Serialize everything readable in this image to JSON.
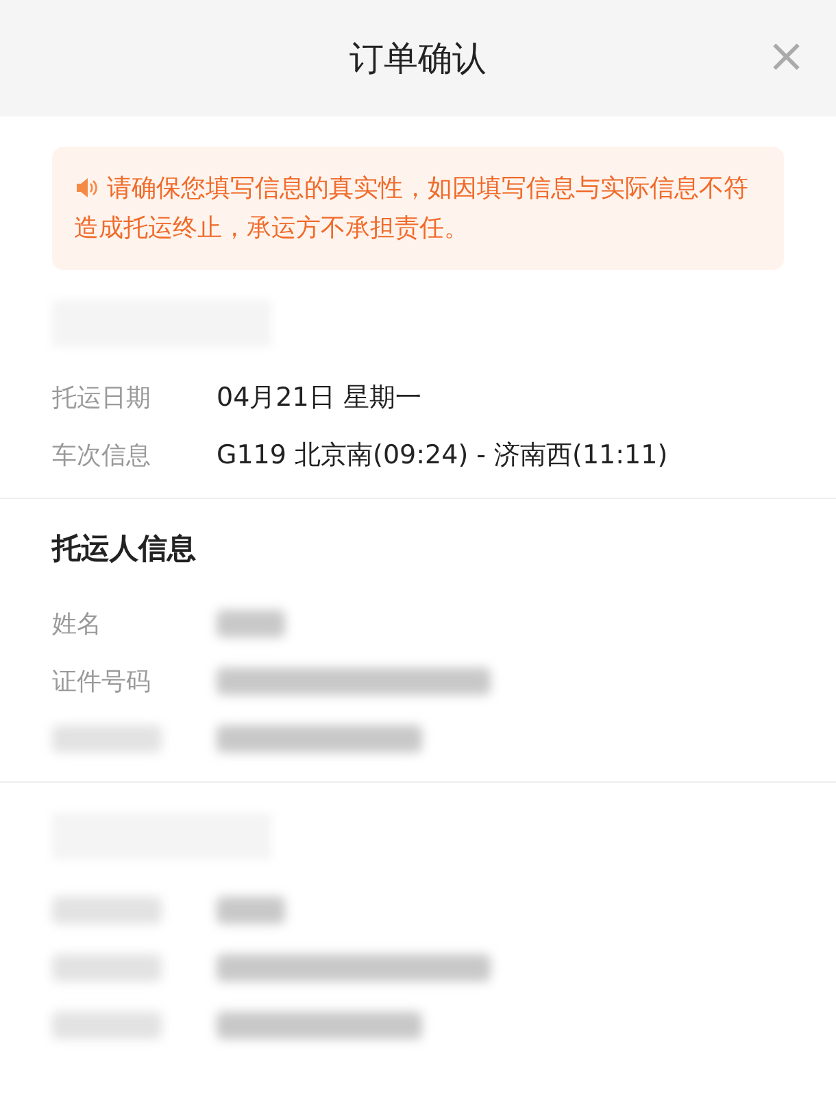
{
  "header": {
    "title": "订单确认",
    "close": "×"
  },
  "notice": {
    "text": "请确保您填写信息的真实性，如因填写信息与实际信息不符造成托运终止，承运方不承担责任。"
  },
  "sections": [
    {
      "rows": [
        {
          "kind": "text",
          "label": "托运日期",
          "value": "04月21日 星期一"
        },
        {
          "kind": "text",
          "label": "车次信息",
          "value": "G119 北京南(09:24) - 济南西(11:11)"
        }
      ]
    },
    {
      "heading": "托运人信息",
      "rows": [
        {
          "kind": "blurred_value",
          "label": "姓名"
        },
        {
          "kind": "blurred_value",
          "label": "证件号码"
        },
        {
          "kind": "blurred"
        }
      ]
    },
    {
      "rows": [
        {
          "kind": "blurred"
        },
        {
          "kind": "blurred"
        },
        {
          "kind": "blurred"
        }
      ]
    }
  ]
}
